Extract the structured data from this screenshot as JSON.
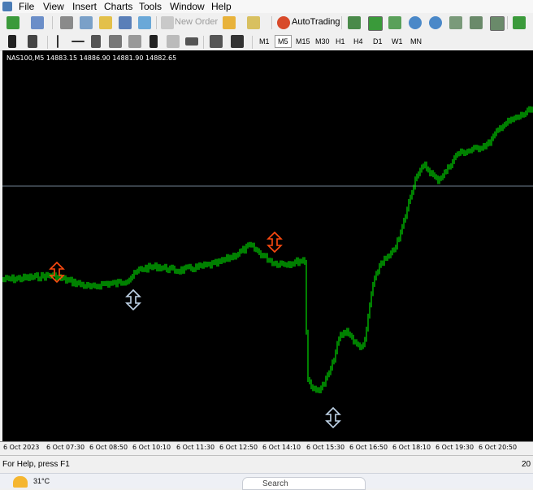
{
  "menubar": {
    "items": [
      "File",
      "View",
      "Insert",
      "Charts",
      "Tools",
      "Window",
      "Help"
    ]
  },
  "toolbar": {
    "new_order_label": "New Order",
    "autotrading_label": "AutoTrading",
    "timeframes": [
      "M1",
      "M5",
      "M15",
      "M30",
      "H1",
      "H4",
      "D1",
      "W1",
      "MN"
    ],
    "active_timeframe": "M5"
  },
  "chart": {
    "title": "NAS100,M5  14883.15 14886.90 14881.90 14882.65",
    "colors": {
      "background": "#000000",
      "candle": "#00ff00",
      "grid_line": "#6f7f90",
      "sell_arrow": "#ff4a10",
      "buy_arrow": "#c0d4e8"
    },
    "time_labels": [
      "6 Oct 2023",
      "6 Oct 07:30",
      "6 Oct 08:50",
      "6 Oct 10:10",
      "6 Oct 11:30",
      "6 Oct 12:50",
      "6 Oct 14:10",
      "6 Oct 15:30",
      "6 Oct 16:50",
      "6 Oct 18:10",
      "6 Oct 19:30",
      "6 Oct 20:50"
    ]
  },
  "statusbar": {
    "help_text": "For Help, press F1",
    "right_text": "20"
  },
  "taskbar": {
    "temperature": "31°C",
    "search_placeholder": "Search"
  }
}
